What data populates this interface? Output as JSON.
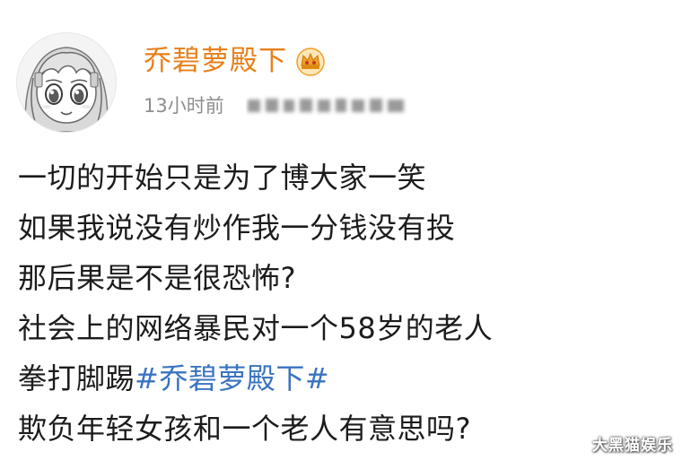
{
  "post": {
    "author": {
      "name": "乔碧萝殿下",
      "badge_icon": "crown-icon",
      "avatar_icon": "anime-girl-avatar"
    },
    "timestamp": "13小时前",
    "source_label_blurred": true,
    "lines": [
      {
        "text": "一切的开始只是为了博大家一笑"
      },
      {
        "text": "如果我说没有炒作我一分钱没有投"
      },
      {
        "text": "那后果是不是很恐怖?"
      },
      {
        "text": "社会上的网络暴民对一个58岁的老人"
      },
      {
        "text": "拳打脚踢",
        "hashtag": "#乔碧萝殿下#"
      },
      {
        "text": "欺负年轻女孩和一个老人有意思吗?"
      }
    ]
  },
  "watermark": "大黑猫娱乐",
  "colors": {
    "username": "#e8801a",
    "hashtag": "#3a73c0",
    "timestamp": "#8e8e8e",
    "body_text": "#1c1c1c",
    "background": "#ffffff",
    "crown": "#f0a028"
  }
}
